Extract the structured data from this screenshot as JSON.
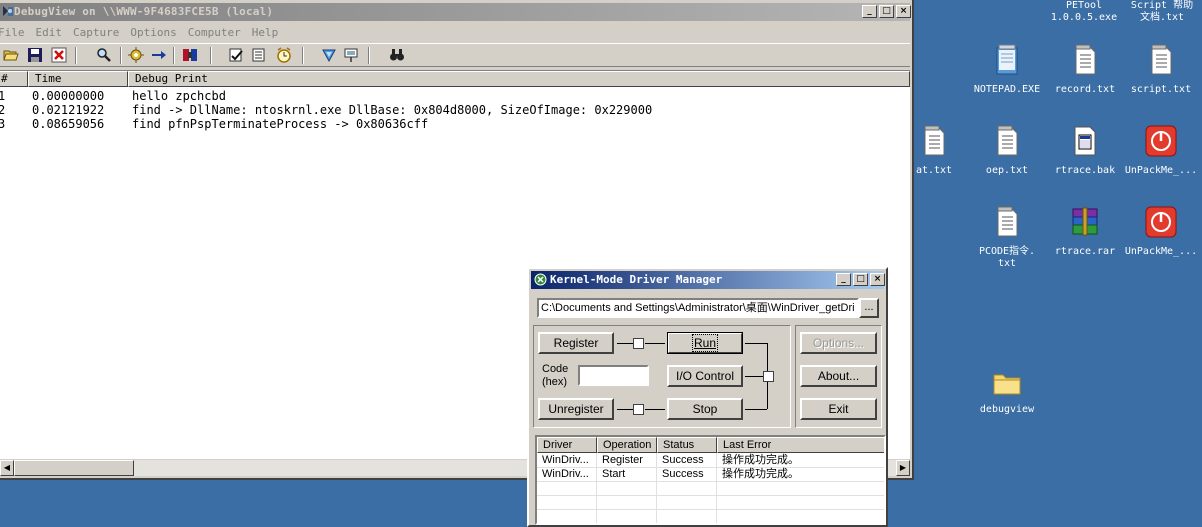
{
  "debugview": {
    "title": "DebugView on \\\\WWW-9F4683FCE5B (local)",
    "menu": [
      "File",
      "Edit",
      "Capture",
      "Options",
      "Computer",
      "Help"
    ],
    "columns": [
      "#",
      "Time",
      "Debug Print"
    ],
    "rows": [
      {
        "num": "1",
        "time": "0.00000000",
        "text": "hello zpchcbd"
      },
      {
        "num": "2",
        "time": "0.02121922",
        "text": "find -> DllName: ntoskrnl.exe DllBase: 0x804d8000, SizeOfImage: 0x229000"
      },
      {
        "num": "3",
        "time": "0.08659056",
        "text": "find pfnPspTerminateProcess -> 0x80636cff"
      }
    ],
    "toolbar_icons": [
      "open-icon",
      "save-icon",
      "clear-icon",
      "find-icon",
      "capture-icon",
      "autoscroll-icon",
      "filter-icon",
      "history-icon",
      "clock-icon",
      "highlight-icon",
      "connect-icon",
      "search-icon"
    ]
  },
  "desktop": {
    "top_labels": [
      {
        "line1": "PETool",
        "line2": "1.0.0.5.exe"
      },
      {
        "line1": "Script 帮助",
        "line2": "文档.txt"
      }
    ],
    "icons": [
      {
        "label": "NOTEPAD.EXE",
        "type": "notepad"
      },
      {
        "label": "record.txt",
        "type": "txt"
      },
      {
        "label": "script.txt",
        "type": "txt"
      },
      {
        "label": "at.txt",
        "type": "txt"
      },
      {
        "label": "oep.txt",
        "type": "txt"
      },
      {
        "label": "rtrace.bak",
        "type": "bak"
      },
      {
        "label": "UnPackMe_...",
        "type": "power"
      },
      {
        "label": "PCODE指令.",
        "label2": "txt",
        "type": "txt"
      },
      {
        "label": "rtrace.rar",
        "type": "rar"
      },
      {
        "label": "UnPackMe_...",
        "type": "power"
      },
      {
        "label": "debugview",
        "type": "folder"
      }
    ]
  },
  "kmdm": {
    "title": "Kernel-Mode Driver Manager",
    "path": "C:\\Documents and Settings\\Administrator\\桌面\\WinDriver_getDri",
    "browse_label": "...",
    "register_label": "Register",
    "run_label": "Run",
    "code_label": "Code",
    "hex_label": "(hex)",
    "code_value": "",
    "io_control_label": "I/O Control",
    "unregister_label": "Unregister",
    "stop_label": "Stop",
    "options_label": "Options...",
    "about_label": "About...",
    "exit_label": "Exit",
    "list_columns": [
      "Driver",
      "Operation",
      "Status",
      "Last Error"
    ],
    "list_rows": [
      {
        "driver": "WinDriv...",
        "operation": "Register",
        "status": "Success",
        "error": "操作成功完成。"
      },
      {
        "driver": "WinDriv...",
        "operation": "Start",
        "status": "Success",
        "error": "操作成功完成。"
      }
    ]
  }
}
